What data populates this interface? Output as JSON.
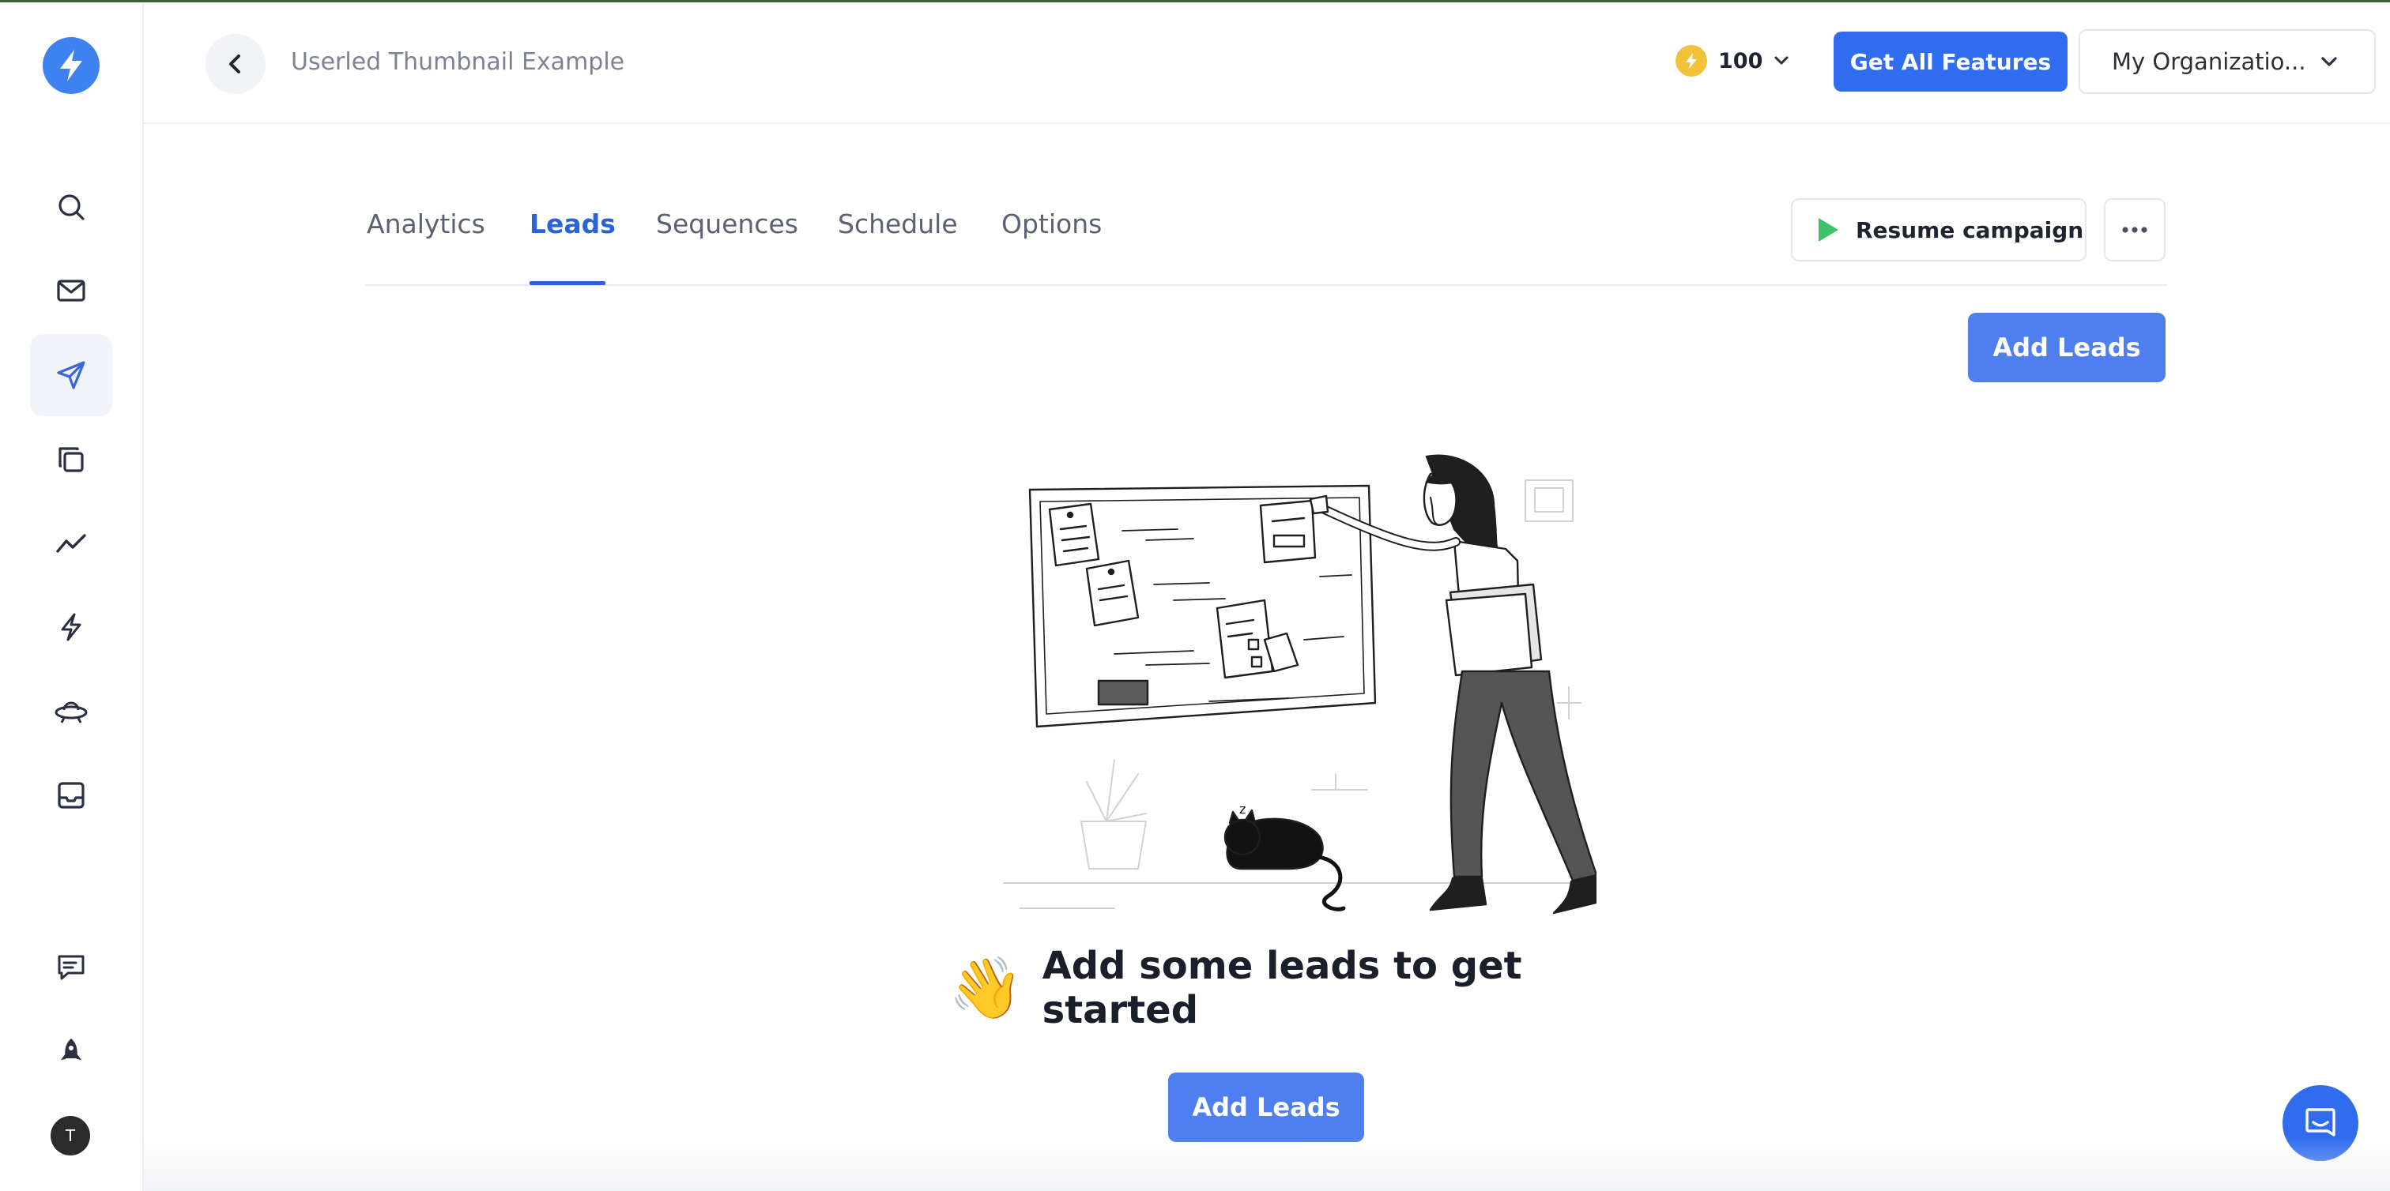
{
  "header": {
    "breadcrumb": "Userled Thumbnail Example",
    "credits": "100",
    "get_all_features": "Get All Features",
    "organization": "My Organizatio..."
  },
  "sidebar": {
    "items": [
      {
        "icon": "search-icon"
      },
      {
        "icon": "mail-icon"
      },
      {
        "icon": "send-icon",
        "active": true
      },
      {
        "icon": "copy-icon"
      },
      {
        "icon": "trend-icon"
      },
      {
        "icon": "bolt-icon"
      },
      {
        "icon": "ufo-icon"
      },
      {
        "icon": "inbox-icon"
      }
    ],
    "bottom": [
      {
        "icon": "feedback-icon"
      },
      {
        "icon": "rocket-icon"
      }
    ],
    "avatar_initial": "T"
  },
  "tabs": [
    {
      "label": "Analytics"
    },
    {
      "label": "Leads",
      "active": true
    },
    {
      "label": "Sequences"
    },
    {
      "label": "Schedule"
    },
    {
      "label": "Options"
    }
  ],
  "actions": {
    "resume": "Resume campaign",
    "add_leads_top": "Add Leads",
    "add_leads_bottom": "Add Leads"
  },
  "empty_state": {
    "emoji": "👋",
    "title": "Add some leads to get started"
  },
  "colors": {
    "primary": "#2f6cf0",
    "button": "#4f7fee",
    "active_tab": "#2a62d8",
    "play": "#3cc26b"
  }
}
